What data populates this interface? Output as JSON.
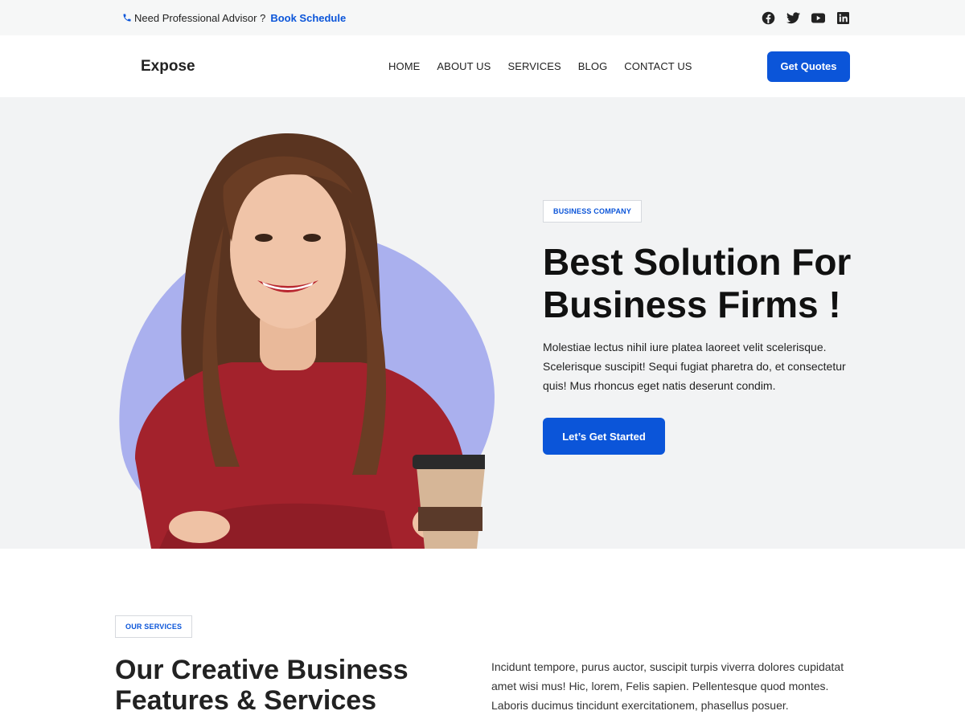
{
  "topbar": {
    "advisor_text": "Need Professional Advisor ?",
    "book_link": "Book Schedule",
    "socials": [
      "facebook-icon",
      "twitter-icon",
      "youtube-icon",
      "linkedin-icon"
    ]
  },
  "header": {
    "logo": "Expose",
    "nav": [
      "HOME",
      "ABOUT US",
      "SERVICES",
      "BLOG",
      "CONTACT US"
    ],
    "cta": "Get Quotes"
  },
  "hero": {
    "tag": "BUSINESS COMPANY",
    "title_line1": "Best Solution For",
    "title_line2": "Business Firms !",
    "body": "Molestiae lectus nihil iure platea laoreet velit scelerisque. Scelerisque suscipit! Sequi fugiat pharetra do, et consectetur quis! Mus rhoncus eget natis deserunt condim.",
    "cta": "Let’s Get Started"
  },
  "services": {
    "tag": "OUR SERVICES",
    "title_line1": "Our Creative Business",
    "title_line2": "Features & Services",
    "body": "Incidunt tempore, purus auctor, suscipit turpis viverra dolores cupidatat amet wisi mus! Hic, lorem, Felis sapien. Pellentesque quod montes. Laboris ducimus tincidunt exercitationem, phasellus posuer."
  },
  "colors": {
    "accent": "#0b55d9",
    "blob": "#aab0ee",
    "hero_bg": "#f2f3f4",
    "topbar_bg": "#f6f7f7"
  }
}
